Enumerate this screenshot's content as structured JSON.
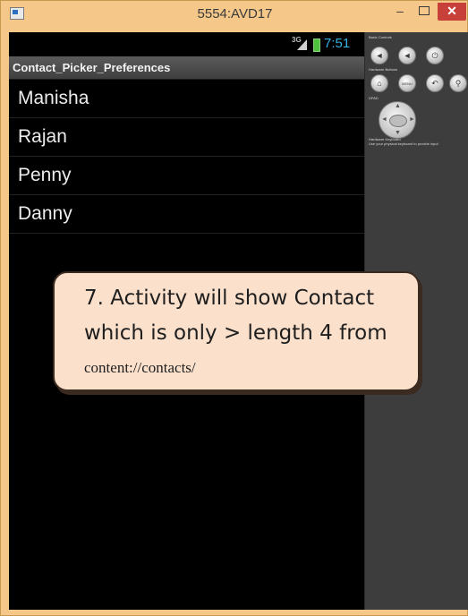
{
  "window": {
    "title": "5554:AVD17",
    "minimize_glyph": "–",
    "close_glyph": "✕"
  },
  "status_bar": {
    "network_type": "3G",
    "time": "7:51",
    "signal_icon": "signal-bars-icon",
    "battery_icon": "battery-icon"
  },
  "action_bar": {
    "title": "Contact_Picker_Preferences"
  },
  "contacts": [
    "Manisha",
    "Rajan",
    "Penny",
    "Danny"
  ],
  "callout": {
    "line1": "7. Activity will show Contact",
    "line2": "which is only > length 4 from",
    "line3": "content://contacts/"
  },
  "controls": {
    "basic_controls_label": "Basic Controls",
    "hardware_buttons_label": "Hardware Buttons",
    "dpad_label": "DPAD",
    "hardware_keyboard_label": "Hardware Keyboard",
    "keyboard_note": "Use your physical keyboard to provide input",
    "menu_label": "MENU"
  },
  "colors": {
    "accent_clock": "#35b3e5",
    "close_button": "#c7413a",
    "callout_fill": "#fbe0cc",
    "window_frame": "#f5c88a"
  }
}
